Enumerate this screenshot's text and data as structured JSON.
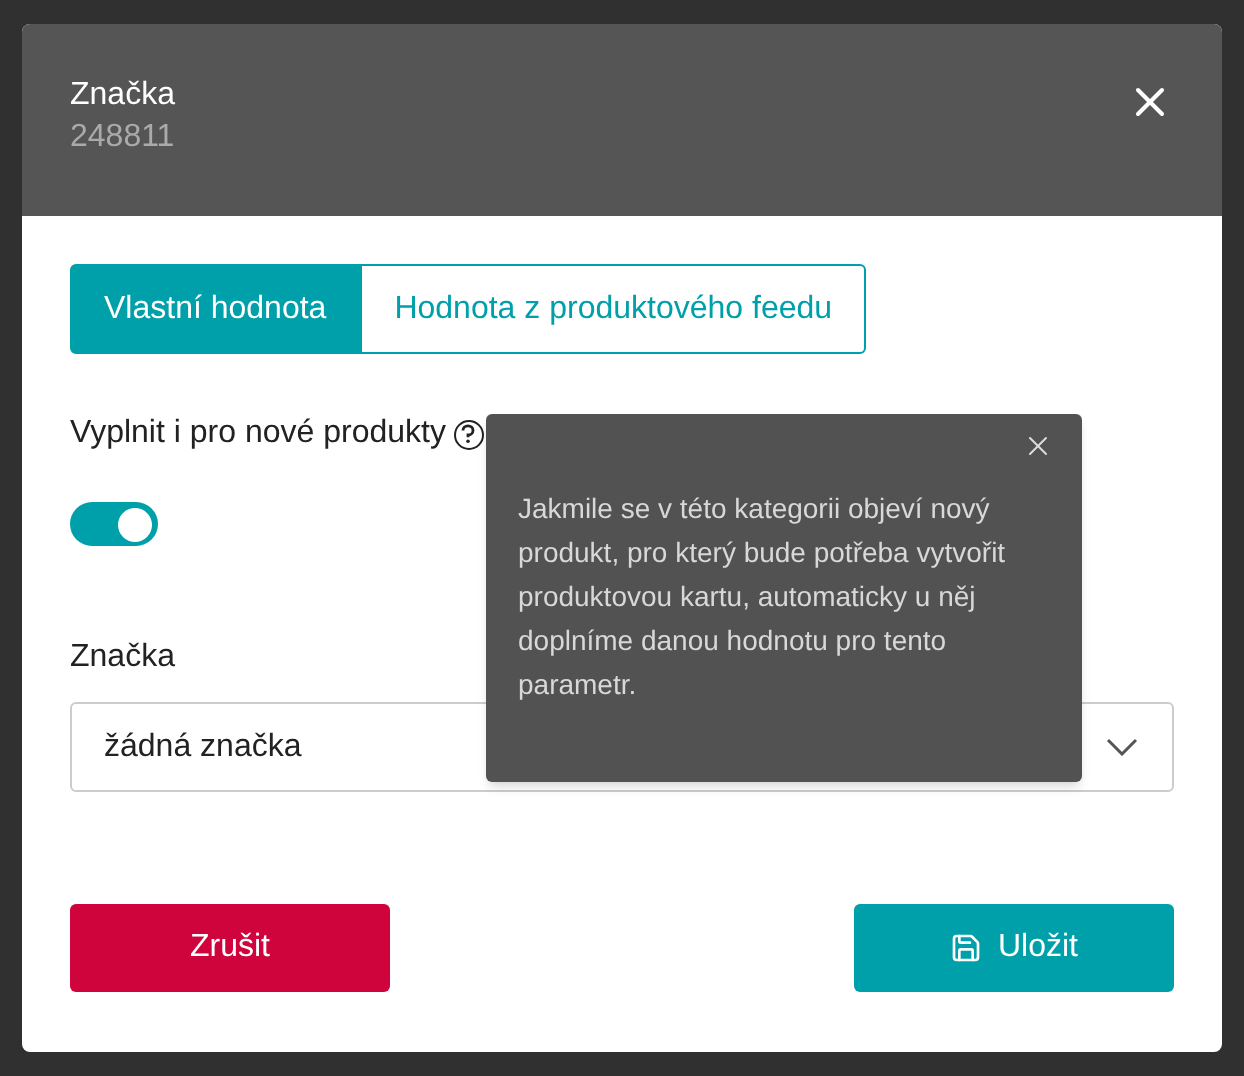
{
  "dialog": {
    "title": "Značka",
    "subtitle": "248811"
  },
  "tabs": [
    {
      "label": "Vlastní hodnota",
      "selected": true
    },
    {
      "label": "Hodnota z produktového feedu",
      "selected": false
    }
  ],
  "fill_new_products": {
    "label": "Vyplnit i pro nové produkty",
    "on": true
  },
  "tooltip": {
    "text": "Jakmile se v této kategorii objeví nový produkt, pro který bude potřeba vytvořit produktovou kartu, automaticky u něj doplníme danou hodnotu pro tento parametr."
  },
  "brand_field": {
    "label": "Značka",
    "value": "žádná značka"
  },
  "buttons": [
    {
      "kind": "cancel",
      "label": "Zrušit"
    },
    {
      "kind": "save",
      "label": "Uložit"
    }
  ]
}
